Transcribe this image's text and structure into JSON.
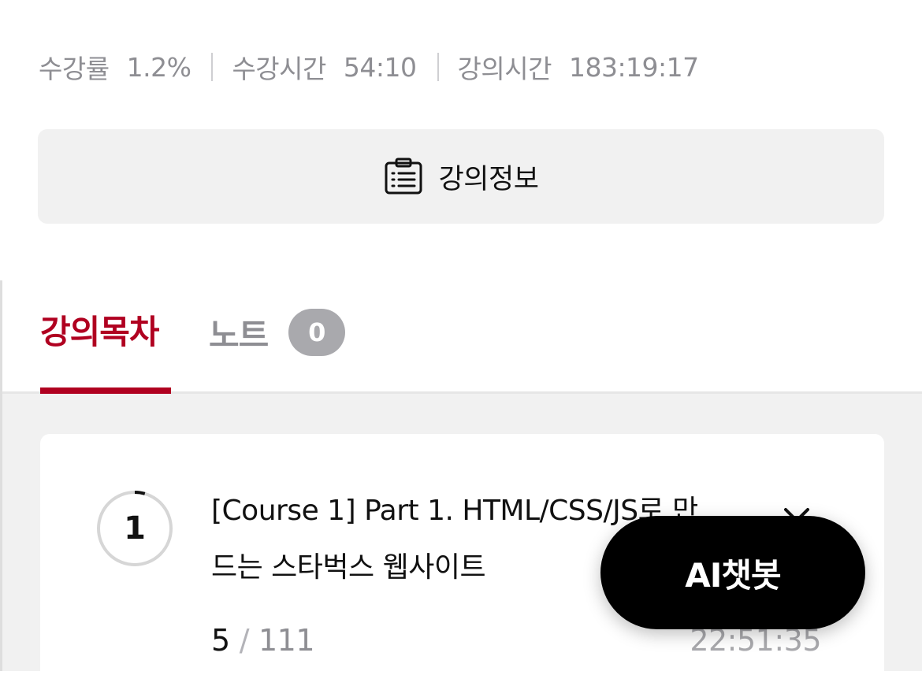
{
  "stats": {
    "progress_label": "수강률",
    "progress_value": "1.2%",
    "watch_time_label": "수강시간",
    "watch_time_value": "54:10",
    "lecture_time_label": "강의시간",
    "lecture_time_value": "183:19:17"
  },
  "info_button": {
    "icon": "clipboard-list-icon",
    "label": "강의정보"
  },
  "tabs": {
    "toc_label": "강의목차",
    "notes_label": "노트",
    "notes_count": "0"
  },
  "course": {
    "number": "1",
    "progress_fraction": 0.045,
    "title": "[Course 1] Part 1. HTML/CSS/JS로 만드는 스타벅스 웹사이트",
    "completed": "5",
    "separator": "/",
    "total": "111",
    "duration": "22:51:35",
    "close_icon": "close-icon"
  },
  "ai_button": {
    "label": "AI챗봇"
  },
  "colors": {
    "accent": "#b00020",
    "muted": "#8e8e93",
    "panel": "#f1f1f1",
    "badge": "#a9a9ad"
  }
}
